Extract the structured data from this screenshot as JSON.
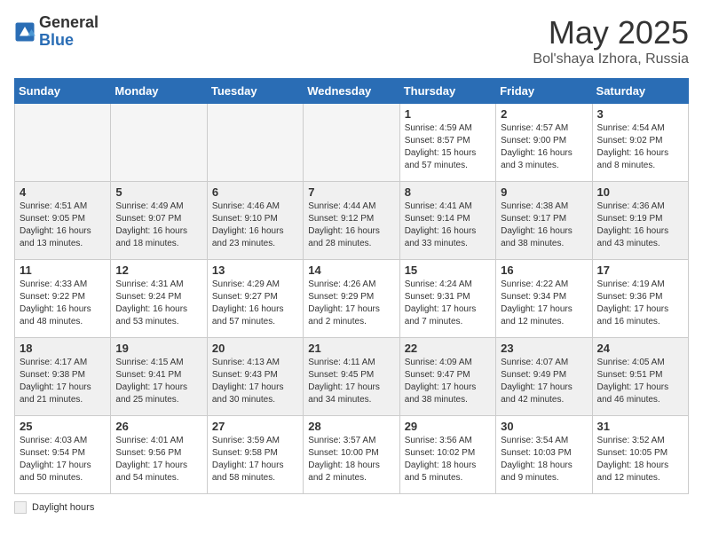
{
  "header": {
    "logo_general": "General",
    "logo_blue": "Blue",
    "title": "May 2025",
    "location": "Bol'shaya Izhora, Russia"
  },
  "days_of_week": [
    "Sunday",
    "Monday",
    "Tuesday",
    "Wednesday",
    "Thursday",
    "Friday",
    "Saturday"
  ],
  "weeks": [
    [
      {
        "day": "",
        "info": "",
        "empty": true
      },
      {
        "day": "",
        "info": "",
        "empty": true
      },
      {
        "day": "",
        "info": "",
        "empty": true
      },
      {
        "day": "",
        "info": "",
        "empty": true
      },
      {
        "day": "1",
        "info": "Sunrise: 4:59 AM\nSunset: 8:57 PM\nDaylight: 15 hours\nand 57 minutes.",
        "empty": false
      },
      {
        "day": "2",
        "info": "Sunrise: 4:57 AM\nSunset: 9:00 PM\nDaylight: 16 hours\nand 3 minutes.",
        "empty": false
      },
      {
        "day": "3",
        "info": "Sunrise: 4:54 AM\nSunset: 9:02 PM\nDaylight: 16 hours\nand 8 minutes.",
        "empty": false
      }
    ],
    [
      {
        "day": "4",
        "info": "Sunrise: 4:51 AM\nSunset: 9:05 PM\nDaylight: 16 hours\nand 13 minutes.",
        "empty": false
      },
      {
        "day": "5",
        "info": "Sunrise: 4:49 AM\nSunset: 9:07 PM\nDaylight: 16 hours\nand 18 minutes.",
        "empty": false
      },
      {
        "day": "6",
        "info": "Sunrise: 4:46 AM\nSunset: 9:10 PM\nDaylight: 16 hours\nand 23 minutes.",
        "empty": false
      },
      {
        "day": "7",
        "info": "Sunrise: 4:44 AM\nSunset: 9:12 PM\nDaylight: 16 hours\nand 28 minutes.",
        "empty": false
      },
      {
        "day": "8",
        "info": "Sunrise: 4:41 AM\nSunset: 9:14 PM\nDaylight: 16 hours\nand 33 minutes.",
        "empty": false
      },
      {
        "day": "9",
        "info": "Sunrise: 4:38 AM\nSunset: 9:17 PM\nDaylight: 16 hours\nand 38 minutes.",
        "empty": false
      },
      {
        "day": "10",
        "info": "Sunrise: 4:36 AM\nSunset: 9:19 PM\nDaylight: 16 hours\nand 43 minutes.",
        "empty": false
      }
    ],
    [
      {
        "day": "11",
        "info": "Sunrise: 4:33 AM\nSunset: 9:22 PM\nDaylight: 16 hours\nand 48 minutes.",
        "empty": false
      },
      {
        "day": "12",
        "info": "Sunrise: 4:31 AM\nSunset: 9:24 PM\nDaylight: 16 hours\nand 53 minutes.",
        "empty": false
      },
      {
        "day": "13",
        "info": "Sunrise: 4:29 AM\nSunset: 9:27 PM\nDaylight: 16 hours\nand 57 minutes.",
        "empty": false
      },
      {
        "day": "14",
        "info": "Sunrise: 4:26 AM\nSunset: 9:29 PM\nDaylight: 17 hours\nand 2 minutes.",
        "empty": false
      },
      {
        "day": "15",
        "info": "Sunrise: 4:24 AM\nSunset: 9:31 PM\nDaylight: 17 hours\nand 7 minutes.",
        "empty": false
      },
      {
        "day": "16",
        "info": "Sunrise: 4:22 AM\nSunset: 9:34 PM\nDaylight: 17 hours\nand 12 minutes.",
        "empty": false
      },
      {
        "day": "17",
        "info": "Sunrise: 4:19 AM\nSunset: 9:36 PM\nDaylight: 17 hours\nand 16 minutes.",
        "empty": false
      }
    ],
    [
      {
        "day": "18",
        "info": "Sunrise: 4:17 AM\nSunset: 9:38 PM\nDaylight: 17 hours\nand 21 minutes.",
        "empty": false
      },
      {
        "day": "19",
        "info": "Sunrise: 4:15 AM\nSunset: 9:41 PM\nDaylight: 17 hours\nand 25 minutes.",
        "empty": false
      },
      {
        "day": "20",
        "info": "Sunrise: 4:13 AM\nSunset: 9:43 PM\nDaylight: 17 hours\nand 30 minutes.",
        "empty": false
      },
      {
        "day": "21",
        "info": "Sunrise: 4:11 AM\nSunset: 9:45 PM\nDaylight: 17 hours\nand 34 minutes.",
        "empty": false
      },
      {
        "day": "22",
        "info": "Sunrise: 4:09 AM\nSunset: 9:47 PM\nDaylight: 17 hours\nand 38 minutes.",
        "empty": false
      },
      {
        "day": "23",
        "info": "Sunrise: 4:07 AM\nSunset: 9:49 PM\nDaylight: 17 hours\nand 42 minutes.",
        "empty": false
      },
      {
        "day": "24",
        "info": "Sunrise: 4:05 AM\nSunset: 9:51 PM\nDaylight: 17 hours\nand 46 minutes.",
        "empty": false
      }
    ],
    [
      {
        "day": "25",
        "info": "Sunrise: 4:03 AM\nSunset: 9:54 PM\nDaylight: 17 hours\nand 50 minutes.",
        "empty": false
      },
      {
        "day": "26",
        "info": "Sunrise: 4:01 AM\nSunset: 9:56 PM\nDaylight: 17 hours\nand 54 minutes.",
        "empty": false
      },
      {
        "day": "27",
        "info": "Sunrise: 3:59 AM\nSunset: 9:58 PM\nDaylight: 17 hours\nand 58 minutes.",
        "empty": false
      },
      {
        "day": "28",
        "info": "Sunrise: 3:57 AM\nSunset: 10:00 PM\nDaylight: 18 hours\nand 2 minutes.",
        "empty": false
      },
      {
        "day": "29",
        "info": "Sunrise: 3:56 AM\nSunset: 10:02 PM\nDaylight: 18 hours\nand 5 minutes.",
        "empty": false
      },
      {
        "day": "30",
        "info": "Sunrise: 3:54 AM\nSunset: 10:03 PM\nDaylight: 18 hours\nand 9 minutes.",
        "empty": false
      },
      {
        "day": "31",
        "info": "Sunrise: 3:52 AM\nSunset: 10:05 PM\nDaylight: 18 hours\nand 12 minutes.",
        "empty": false
      }
    ]
  ],
  "footer": {
    "legend_label": "Daylight hours"
  }
}
